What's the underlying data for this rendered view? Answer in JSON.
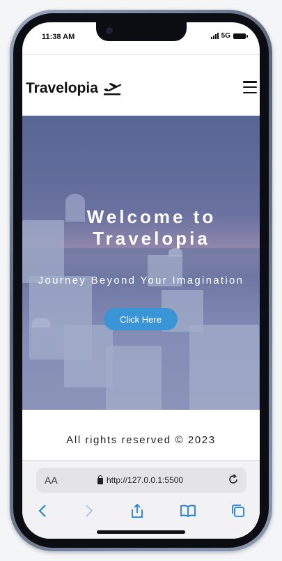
{
  "status_bar": {
    "time": "11:38 AM",
    "network": "5G"
  },
  "header": {
    "brand": "Travelopia"
  },
  "hero": {
    "title_line1": "Welcome to",
    "title_line2": "Travelopia",
    "subtitle": "Journey Beyond Your Imagination",
    "cta_label": "Click Here"
  },
  "footer": {
    "copyright": "All rights reserved © 2023"
  },
  "browser": {
    "aa_label": "AA",
    "url": "http://127.0.0.1:5500"
  },
  "colors": {
    "cta": "#3a95d6",
    "toolbar_icons": "#1a7fe0"
  }
}
